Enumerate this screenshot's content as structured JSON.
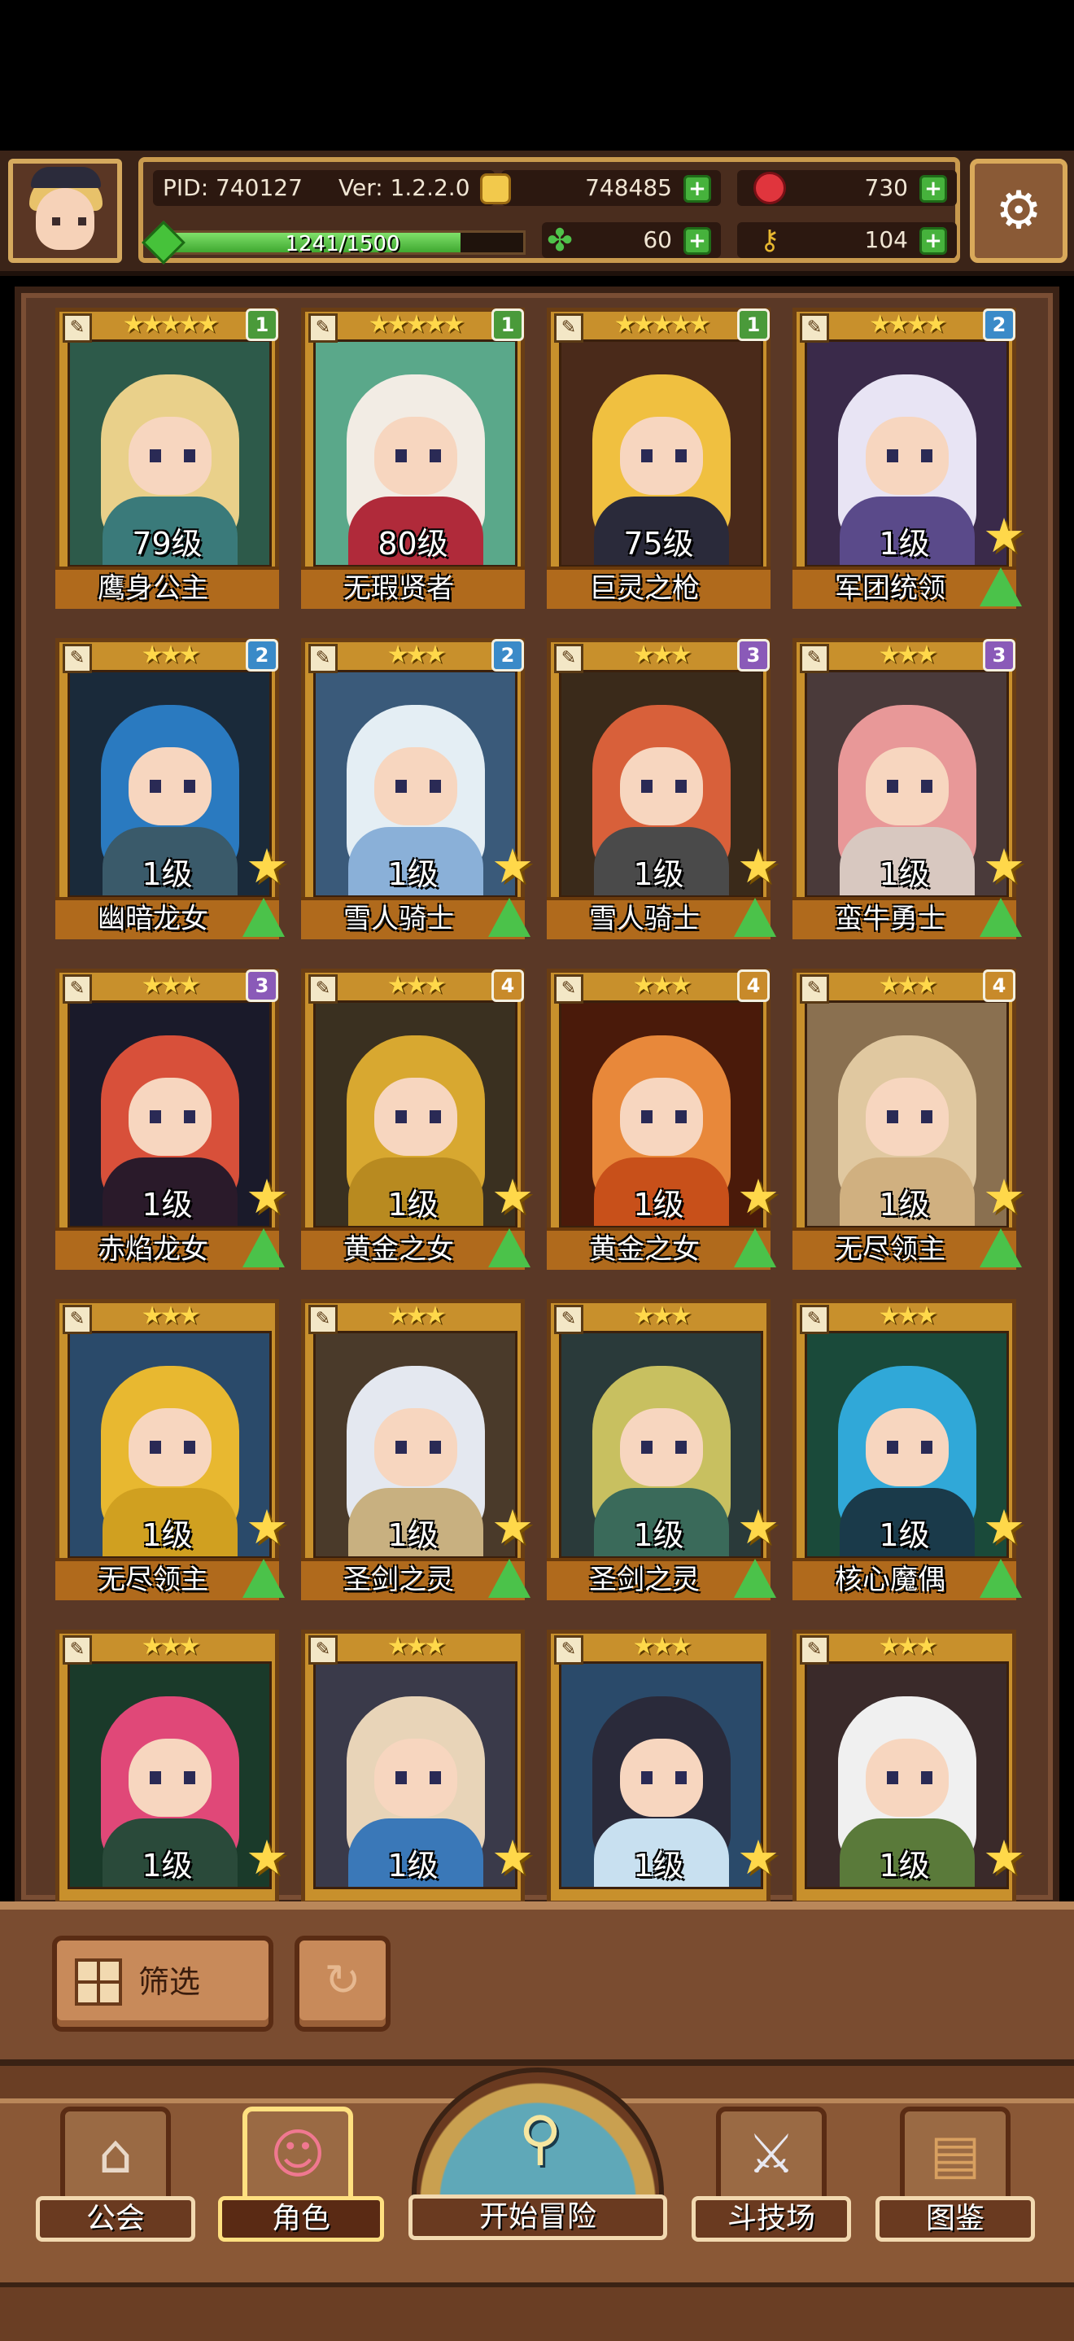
{
  "header": {
    "pid": "PID: 740127",
    "version": "Ver: 1.2.2.0",
    "gold": "748485",
    "gems": "730",
    "exp_text": "1241/1500",
    "exp_ratio": 0.827,
    "clover": "60",
    "keys": "104",
    "icons": {
      "gold": "coin-icon",
      "gems": "gem-icon",
      "clover": "clover-icon",
      "keys": "key-icon",
      "settings": "gear-icon"
    }
  },
  "cards": [
    {
      "level": "79级",
      "name": "鹰身公主",
      "badge": "1",
      "badge_color": "#4a9a3a",
      "stars": "★★★★★",
      "hair": "#e9d08a",
      "body": "#3a7a7a",
      "bg": "#2d5a4a",
      "fav": false,
      "upgrade": false
    },
    {
      "level": "80级",
      "name": "无瑕贤者",
      "badge": "1",
      "badge_color": "#4a9a3a",
      "stars": "★★★★★",
      "hair": "#f2ece4",
      "body": "#b02a3a",
      "bg": "#5aa88a",
      "fav": false,
      "upgrade": false
    },
    {
      "level": "75级",
      "name": "巨灵之枪",
      "badge": "1",
      "badge_color": "#4a9a3a",
      "stars": "★★★★★",
      "hair": "#f0c040",
      "body": "#2a2a3a",
      "bg": "#4a2a1a",
      "fav": false,
      "upgrade": false
    },
    {
      "level": "1级",
      "name": "军团统领",
      "badge": "2",
      "badge_color": "#3a8ac8",
      "stars": "★★★★",
      "hair": "#e8e4f4",
      "body": "#5a4a8a",
      "bg": "#3a2a4a",
      "fav": true,
      "upgrade": true
    },
    {
      "level": "1级",
      "name": "幽暗龙女",
      "badge": "2",
      "badge_color": "#3a8ac8",
      "stars": "★★★",
      "hair": "#2a7ac0",
      "body": "#3a5a6a",
      "bg": "#1a2a3a",
      "fav": true,
      "upgrade": true
    },
    {
      "level": "1级",
      "name": "雪人骑士",
      "badge": "2",
      "badge_color": "#3a8ac8",
      "stars": "★★★",
      "hair": "#e4eef4",
      "body": "#8ab0d8",
      "bg": "#3a5a7a",
      "fav": true,
      "upgrade": true
    },
    {
      "level": "1级",
      "name": "雪人骑士",
      "badge": "3",
      "badge_color": "#8a5ab8",
      "stars": "★★★",
      "hair": "#d8603a",
      "body": "#4a4a4a",
      "bg": "#3a2a1a",
      "fav": true,
      "upgrade": true
    },
    {
      "level": "1级",
      "name": "蛮牛勇士",
      "badge": "3",
      "badge_color": "#8a5ab8",
      "stars": "★★★",
      "hair": "#e89898",
      "body": "#d8c8c0",
      "bg": "#4a3a3a",
      "fav": true,
      "upgrade": true
    },
    {
      "level": "1级",
      "name": "赤焰龙女",
      "badge": "3",
      "badge_color": "#8a5ab8",
      "stars": "★★★",
      "hair": "#d8503a",
      "body": "#2a1a2a",
      "bg": "#1a1a2a",
      "fav": true,
      "upgrade": true
    },
    {
      "level": "1级",
      "name": "黄金之女",
      "badge": "4",
      "badge_color": "#c88a2a",
      "stars": "★★★",
      "hair": "#d8a830",
      "body": "#b88a20",
      "bg": "#3a3020",
      "fav": true,
      "upgrade": true
    },
    {
      "level": "1级",
      "name": "黄金之女",
      "badge": "4",
      "badge_color": "#c88a2a",
      "stars": "★★★",
      "hair": "#e8883a",
      "body": "#c8501a",
      "bg": "#4a1a0a",
      "fav": true,
      "upgrade": true
    },
    {
      "level": "1级",
      "name": "无尽领主",
      "badge": "4",
      "badge_color": "#c88a2a",
      "stars": "★★★",
      "hair": "#e0c8a0",
      "body": "#d0b080",
      "bg": "#8a7050",
      "fav": true,
      "upgrade": true
    },
    {
      "level": "1级",
      "name": "无尽领主",
      "badge": "",
      "badge_color": "",
      "stars": "★★★",
      "hair": "#e8b830",
      "body": "#d0a020",
      "bg": "#2a4a6a",
      "fav": true,
      "upgrade": true
    },
    {
      "level": "1级",
      "name": "圣剑之灵",
      "badge": "",
      "badge_color": "",
      "stars": "★★★",
      "hair": "#e4e8f0",
      "body": "#c8b080",
      "bg": "#4a3a2a",
      "fav": true,
      "upgrade": true
    },
    {
      "level": "1级",
      "name": "圣剑之灵",
      "badge": "",
      "badge_color": "",
      "stars": "★★★",
      "hair": "#c8c060",
      "body": "#3a6a5a",
      "bg": "#2a3a3a",
      "fav": true,
      "upgrade": true
    },
    {
      "level": "1级",
      "name": "核心魔偶",
      "badge": "",
      "badge_color": "",
      "stars": "★★★",
      "hair": "#30a8d8",
      "body": "#1a3a4a",
      "bg": "#1a4a3a",
      "fav": true,
      "upgrade": true
    },
    {
      "level": "1级",
      "name": "",
      "badge": "",
      "badge_color": "",
      "stars": "★★★",
      "hair": "#e04878",
      "body": "#2a4a3a",
      "bg": "#1a3a2a",
      "fav": true,
      "upgrade": false
    },
    {
      "level": "1级",
      "name": "",
      "badge": "",
      "badge_color": "",
      "stars": "★★★",
      "hair": "#e8d4b8",
      "body": "#3a78b8",
      "bg": "#3a3a4a",
      "fav": true,
      "upgrade": false
    },
    {
      "level": "1级",
      "name": "",
      "badge": "",
      "badge_color": "",
      "stars": "★★★",
      "hair": "#2a2a3a",
      "body": "#c8e0f0",
      "bg": "#2a4a6a",
      "fav": true,
      "upgrade": false
    },
    {
      "level": "1级",
      "name": "",
      "badge": "",
      "badge_color": "",
      "stars": "★★★",
      "hair": "#f0f0f0",
      "body": "#5a7a3a",
      "bg": "#3a2a2a",
      "fav": true,
      "upgrade": false
    }
  ],
  "filter": {
    "label": "筛选",
    "icons": {
      "filter": "grid-icon",
      "refresh": "refresh-icon"
    }
  },
  "nav": {
    "guild": "公会",
    "character": "角色",
    "adventure": "开始冒险",
    "arena": "斗技场",
    "codex": "图鉴",
    "active": "character"
  }
}
